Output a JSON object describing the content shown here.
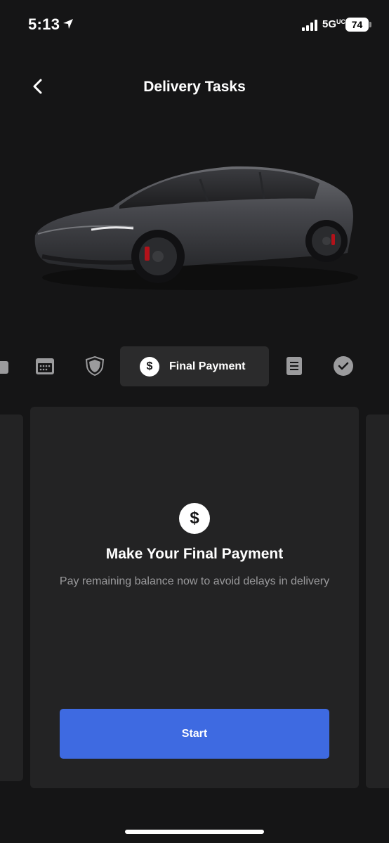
{
  "status_bar": {
    "time": "5:13",
    "network": "5G",
    "network_sub": "UC",
    "battery": "74"
  },
  "header": {
    "title": "Delivery Tasks"
  },
  "tabs": {
    "items": [
      {
        "icon": "gift-icon"
      },
      {
        "icon": "calendar-icon"
      },
      {
        "icon": "shield-icon"
      },
      {
        "icon": "dollar-icon",
        "label": "Final Payment",
        "active": true,
        "symbol": "$"
      },
      {
        "icon": "document-icon"
      },
      {
        "icon": "checkmark-icon"
      }
    ]
  },
  "card": {
    "icon_symbol": "$",
    "title": "Make Your Final Payment",
    "description": "Pay remaining balance now to avoid delays in delivery",
    "button_label": "Start"
  },
  "colors": {
    "background": "#151516",
    "card": "#232324",
    "accent": "#3e6ae1"
  }
}
